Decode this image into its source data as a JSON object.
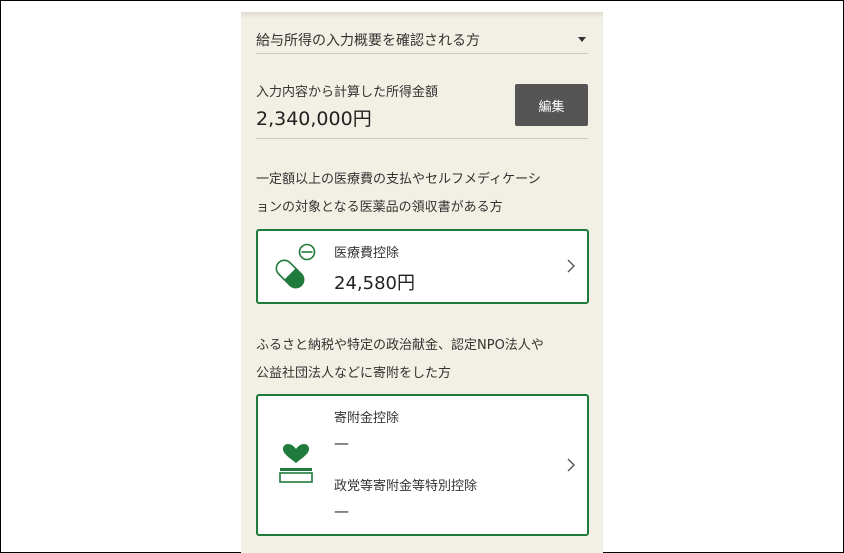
{
  "dropdown": {
    "label": "給与所得の入力概要を確認される方"
  },
  "income": {
    "label": "入力内容から計算した所得金額",
    "amount": "2,340,000円",
    "edit_label": "編集"
  },
  "medical": {
    "description_line1": "一定額以上の医療費の支払やセルフメディケーシ",
    "description_line2": "ョンの対象となる医薬品の領収書がある方",
    "card_title": "医療費控除",
    "card_value": "24,580円",
    "icon": "pill-icon"
  },
  "donation": {
    "description_line1": "ふるさと納税や特定の政治献金、認定NPO法人や",
    "description_line2": "公益社団法人などに寄附をした方",
    "item1_title": "寄附金控除",
    "item1_value": "—",
    "item2_title": "政党等寄附金等特別控除",
    "item2_value": "—",
    "icon": "donation-box-icon"
  },
  "colors": {
    "accent": "#1e7b3c",
    "panel_bg": "#f2efe4",
    "button_bg": "#555555"
  }
}
